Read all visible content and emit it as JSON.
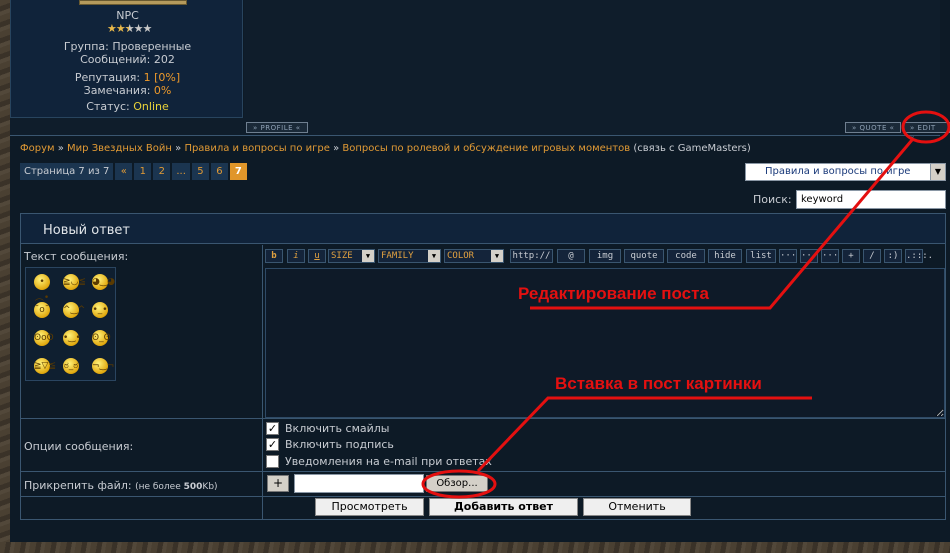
{
  "profile": {
    "name": "NPC",
    "rating_stars": 2.5,
    "group_label": "Группа:",
    "group_value": "Проверенные",
    "messages_label": "Сообщений:",
    "messages_value": "202",
    "reputation_label": "Репутация:",
    "reputation_value": "1 [0%]",
    "warnings_label": "Замечания:",
    "warnings_value": "0%",
    "status_label": "Статус:",
    "status_value": "Online"
  },
  "post_buttons": {
    "profile": "PROFILE",
    "quote": "QUOTE",
    "edit": "EDIT"
  },
  "breadcrumb": {
    "items": [
      "Форум",
      "Мир Звездных Войн",
      "Правила и вопросы по игре",
      "Вопросы по ролевой и обсуждение игровых моментов"
    ],
    "separator": "»",
    "suffix": "(связь с GameMasters)"
  },
  "pagination": {
    "label": "Страница 7 из 7",
    "items": [
      "«",
      "1",
      "2",
      "...",
      "5",
      "6"
    ],
    "current": "7"
  },
  "forum_select": {
    "value": "Правила и вопросы по игре"
  },
  "search": {
    "label": "Поиск:",
    "value": "keyword"
  },
  "reply_form": {
    "title": "Новый ответ",
    "message_label": "Текст сообщения:",
    "toolbar": {
      "b": "b",
      "i": "i",
      "u": "u",
      "size": "SIZE",
      "family": "FAMILY",
      "color": "COLOR",
      "http": "http://",
      "at": "@",
      "img": "img",
      "quote": "quote",
      "code": "code",
      "hide": "hide",
      "list": "list",
      "dots1": "···",
      "dots2": "···",
      "dots3": "···",
      "plus": "+",
      "slash": "/",
      "smile": ":)",
      "more": ".:::."
    },
    "options_label": "Опции сообщения:",
    "options": [
      {
        "label": "Включить смайлы",
        "checked": "✓"
      },
      {
        "label": "Включить подпись",
        "checked": "✓"
      },
      {
        "label": "Уведомления на e-mail при ответах",
        "checked": ""
      }
    ],
    "attach_label": "Прикрепить файл:",
    "attach_limit_prefix": "(не более",
    "attach_limit_size": "500",
    "attach_limit_suffix": "Kb)",
    "plus_label": "+",
    "browse_label": "Обзор...",
    "preview_label": "Просмотреть",
    "submit_label": "Добавить ответ",
    "cancel_label": "Отменить"
  },
  "annotations": {
    "edit_post": "Редактирование поста",
    "insert_image": "Вставка в пост картинки"
  },
  "colors": {
    "accent": "#e0962a",
    "annotation": "#e41010",
    "link": "#e19a35"
  }
}
